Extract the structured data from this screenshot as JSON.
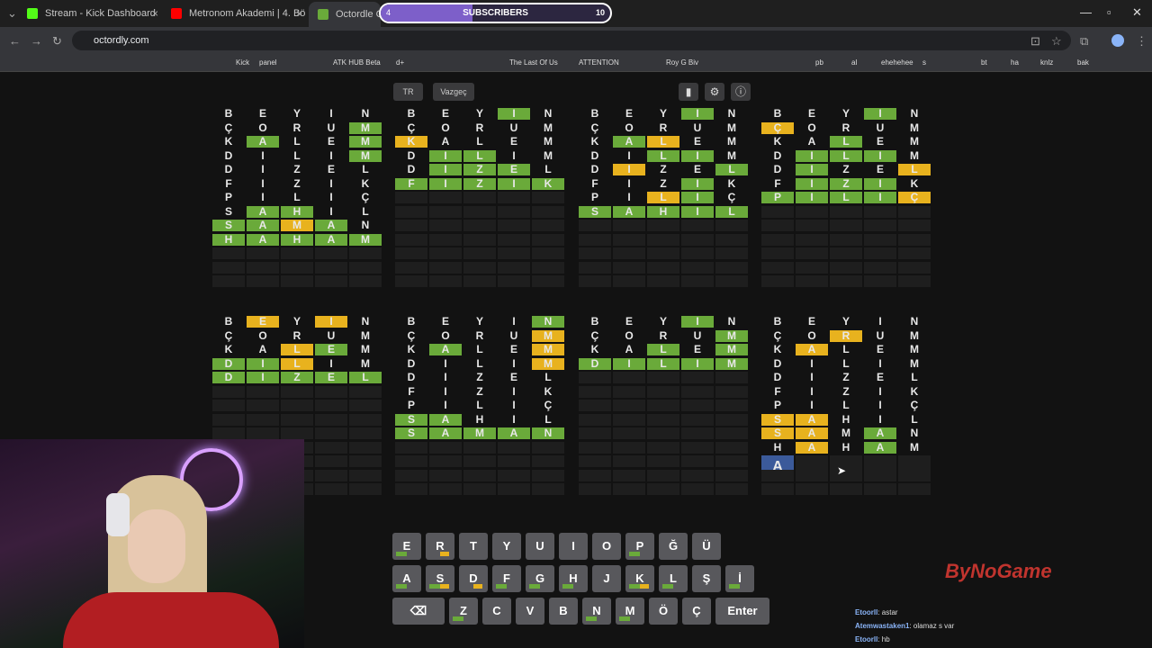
{
  "browser": {
    "tabs": [
      {
        "title": "Stream - Kick Dashboard",
        "color": "#53fc18"
      },
      {
        "title": "Metronom Akademi | 4. Bölüm",
        "color": "#ff0000"
      },
      {
        "title": "Octordle Game",
        "color": "#6aaa3a"
      }
    ],
    "url": "octordly.com",
    "subscribers": {
      "label": "SUBSCRIBERS",
      "current": "4",
      "goal": "10",
      "progress": 0.4
    },
    "bookmarks": [
      "Kick",
      "panel",
      "ATK HUB Beta",
      "d+",
      "The Last Of Us",
      "ATTENTION",
      "Roy G Biv",
      "pb",
      "al",
      "ehehehee",
      "s",
      "bt",
      "ha",
      "knlz",
      "bak"
    ]
  },
  "game": {
    "lang_label": "TR",
    "quit_label": "Vazgeç",
    "boards": [
      {
        "rows": [
          [
            "B.",
            "E.",
            "Y.",
            "I.",
            "N."
          ],
          [
            "Ç.",
            "O.",
            "R.",
            "U.",
            "Mg"
          ],
          [
            "K.",
            "Ag",
            "L.",
            "E.",
            "Mg"
          ],
          [
            "D.",
            "I.",
            "L.",
            "I.",
            "Mg"
          ],
          [
            "D.",
            "I.",
            "Z.",
            "E.",
            "L."
          ],
          [
            "F.",
            "I.",
            "Z.",
            "I.",
            "K."
          ],
          [
            "P.",
            "I.",
            "L.",
            "I.",
            "Ç."
          ],
          [
            "S.",
            "Ag",
            "Hg",
            "I.",
            "L."
          ],
          [
            "Sg",
            "Ag",
            "My",
            "Ag",
            "N."
          ],
          [
            "Hg",
            "Ag",
            "Hg",
            "Ag",
            "Mg"
          ]
        ]
      },
      {
        "rows": [
          [
            "B.",
            "E.",
            "Y.",
            "Ig",
            "N."
          ],
          [
            "Ç.",
            "O.",
            "R.",
            "U.",
            "M."
          ],
          [
            "Ky",
            "A.",
            "L.",
            "E.",
            "M."
          ],
          [
            "D.",
            "Ig",
            "Lg",
            "I.",
            "M."
          ],
          [
            "D.",
            "Ig",
            "Zg",
            "Eg",
            "L."
          ],
          [
            "Fg",
            "Ig",
            "Zg",
            "Ig",
            "Kg"
          ]
        ]
      },
      {
        "rows": [
          [
            "B.",
            "E.",
            "Y.",
            "Ig",
            "N."
          ],
          [
            "Ç.",
            "O.",
            "R.",
            "U.",
            "M."
          ],
          [
            "K.",
            "Ag",
            "Ly",
            "E.",
            "M."
          ],
          [
            "D.",
            "I.",
            "Lg",
            "Ig",
            "M."
          ],
          [
            "D.",
            "Iy",
            "Z.",
            "E.",
            "Lg"
          ],
          [
            "F.",
            "I.",
            "Z.",
            "Ig",
            "K."
          ],
          [
            "P.",
            "I.",
            "Ly",
            "Ig",
            "Ç."
          ],
          [
            "Sg",
            "Ag",
            "Hg",
            "Ig",
            "Lg"
          ]
        ]
      },
      {
        "rows": [
          [
            "B.",
            "E.",
            "Y.",
            "Ig",
            "N."
          ],
          [
            "Çy",
            "O.",
            "R.",
            "U.",
            "M."
          ],
          [
            "K.",
            "A.",
            "Lg",
            "E.",
            "M."
          ],
          [
            "D.",
            "Ig",
            "Lg",
            "Ig",
            "M."
          ],
          [
            "D.",
            "Ig",
            "Z.",
            "E.",
            "Ly"
          ],
          [
            "F.",
            "Ig",
            "Zg",
            "Ig",
            "K."
          ],
          [
            "Pg",
            "Ig",
            "Lg",
            "Ig",
            "Çy"
          ]
        ]
      },
      {
        "rows": [
          [
            "B.",
            "Ey",
            "Y.",
            "Iy",
            "N."
          ],
          [
            "Ç.",
            "O.",
            "R.",
            "U.",
            "M."
          ],
          [
            "K.",
            "A.",
            "Ly",
            "Eg",
            "M."
          ],
          [
            "Dg",
            "Ig",
            "Ly",
            "I.",
            "M."
          ],
          [
            "Dg",
            "Ig",
            "Zg",
            "Eg",
            "Lg"
          ]
        ]
      },
      {
        "rows": [
          [
            "B.",
            "E.",
            "Y.",
            "I.",
            "Ng"
          ],
          [
            "Ç.",
            "O.",
            "R.",
            "U.",
            "My"
          ],
          [
            "K.",
            "Ag",
            "L.",
            "E.",
            "My"
          ],
          [
            "D.",
            "I.",
            "L.",
            "I.",
            "My"
          ],
          [
            "D.",
            "I.",
            "Z.",
            "E.",
            "L."
          ],
          [
            "F.",
            "I.",
            "Z.",
            "I.",
            "K."
          ],
          [
            "P.",
            "I.",
            "L.",
            "I.",
            "Ç."
          ],
          [
            "Sg",
            "Ag",
            "H.",
            "I.",
            "L."
          ],
          [
            "Sg",
            "Ag",
            "Mg",
            "Ag",
            "Ng"
          ]
        ]
      },
      {
        "rows": [
          [
            "B.",
            "E.",
            "Y.",
            "Ig",
            "N."
          ],
          [
            "Ç.",
            "O.",
            "R.",
            "U.",
            "Mg"
          ],
          [
            "K.",
            "A.",
            "Lg",
            "E.",
            "Mg"
          ],
          [
            "Dg",
            "Ig",
            "Lg",
            "Ig",
            "Mg"
          ]
        ]
      },
      {
        "rows": [
          [
            "B.",
            "E.",
            "Y.",
            "I.",
            "N."
          ],
          [
            "Ç.",
            "O.",
            "Ry",
            "U.",
            "M."
          ],
          [
            "K.",
            "Ay",
            "L.",
            "E.",
            "M."
          ],
          [
            "D.",
            "I.",
            "L.",
            "I.",
            "M."
          ],
          [
            "D.",
            "I.",
            "Z.",
            "E.",
            "L."
          ],
          [
            "F.",
            "I.",
            "Z.",
            "I.",
            "K."
          ],
          [
            "P.",
            "I.",
            "L.",
            "I.",
            "Ç."
          ],
          [
            "Sy",
            "Ay",
            "H.",
            "I.",
            "L."
          ],
          [
            "Sy",
            "Ay",
            "M.",
            "Ag",
            "N."
          ],
          [
            "H.",
            "Ay",
            "H.",
            "Ag",
            "M."
          ]
        ],
        "input": "A"
      }
    ],
    "keyboard": {
      "row1": [
        "E",
        "R",
        "T",
        "Y",
        "U",
        "I",
        "O",
        "P",
        "Ğ",
        "Ü"
      ],
      "row2": [
        "A",
        "S",
        "D",
        "F",
        "G",
        "H",
        "J",
        "K",
        "L",
        "Ş",
        "İ"
      ],
      "row3": [
        "⌫",
        "Z",
        "C",
        "V",
        "B",
        "N",
        "M",
        "Ö",
        "Ç",
        "Enter"
      ]
    }
  },
  "overlay": {
    "watermark": "ByNoGame",
    "chat": [
      {
        "user": "Etoorll",
        "msg": ": astar"
      },
      {
        "user": "Atemwastaken1",
        "msg": ": olamaz s var"
      },
      {
        "user": "Etoorll",
        "msg": ": hb"
      }
    ]
  },
  "colors": {
    "green": "#6aaa3a",
    "yellow": "#e8b21e",
    "purple": "#7d5fc9"
  }
}
